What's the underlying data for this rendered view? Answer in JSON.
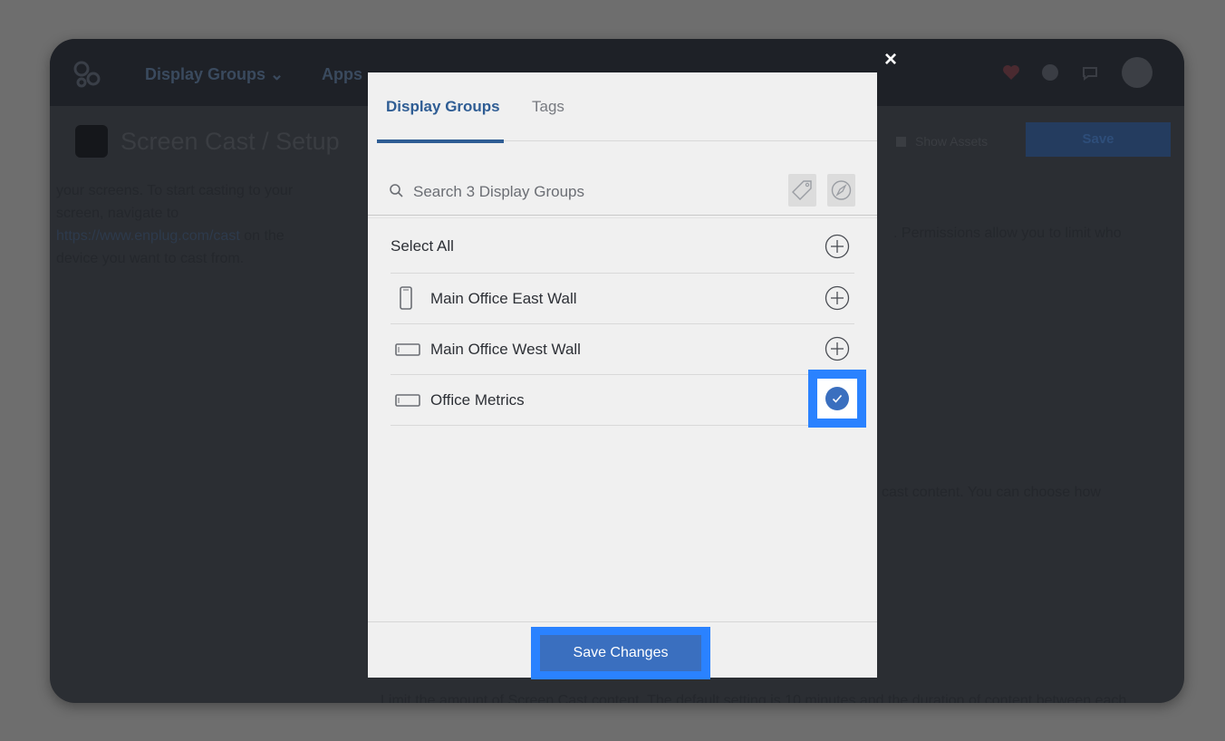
{
  "background": {
    "nav": {
      "display_groups": "Display Groups ⌄",
      "apps": "Apps"
    },
    "page_title": "Screen Cast / Setup",
    "show_assets": "Show Assets",
    "save_label": "Save",
    "left_text_1": "your screens. To start casting to your screen, navigate to ",
    "left_link": "https://www.enplug.com/cast",
    "left_text_2": " on the device you want to cast from.",
    "right_text_1": ". Permissions allow you to limit who",
    "right_text_2": "cast content. You can choose how",
    "bottom_text": "Limit the amount of Screen Cast content. The default setting is 10 minutes and the duration of content between each"
  },
  "modal": {
    "close_glyph": "×",
    "tabs": [
      {
        "label": "Display Groups",
        "active": true
      },
      {
        "label": "Tags",
        "active": false
      }
    ],
    "search": {
      "placeholder": "Search 3 Display Groups",
      "value": ""
    },
    "select_all_label": "Select All",
    "items": [
      {
        "label": "Main Office East Wall",
        "device_icon": "phone-portrait-icon",
        "selected": false
      },
      {
        "label": "Main Office West Wall",
        "device_icon": "display-landscape-icon",
        "selected": false
      },
      {
        "label": "Office Metrics",
        "device_icon": "display-landscape-icon",
        "selected": true
      }
    ],
    "save_button_label": "Save Changes"
  },
  "colors": {
    "accent": "#3a6fbf",
    "active_tab": "#2f5d94",
    "highlight": "#2a82ff",
    "overlay": "#6e6e6e"
  }
}
